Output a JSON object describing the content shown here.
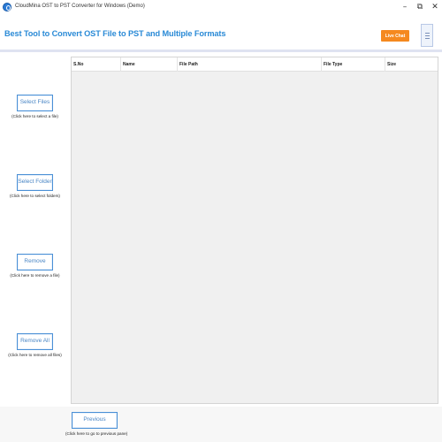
{
  "window": {
    "title": "CloudMina OST to PST Converter for Windows (Demo)",
    "controls": {
      "minimize": "–",
      "maximize": "⧉",
      "close": "✕"
    }
  },
  "header": {
    "title": "Best Tool to Convert OST File to PST and Multiple Formats",
    "live_chat_label": "Live Chat",
    "title_color": "#2a8ad6",
    "accent_color": "#f5891f"
  },
  "actions": [
    {
      "label": "Select Files",
      "hint": "(Click here to select a file)"
    },
    {
      "label": "Select Folder",
      "hint": "(Click here to select folders)"
    },
    {
      "label": "Remove",
      "hint": "(Click here to remove a file)"
    },
    {
      "label": "Remove All",
      "hint": "(Click here to remove all files)"
    }
  ],
  "table": {
    "columns": [
      "S.No",
      "Name",
      "File Path",
      "File Type",
      "Size"
    ],
    "rows": []
  },
  "navigation": {
    "previous_label": "Previous",
    "previous_hint": "(Click here to go to previous pane)"
  }
}
